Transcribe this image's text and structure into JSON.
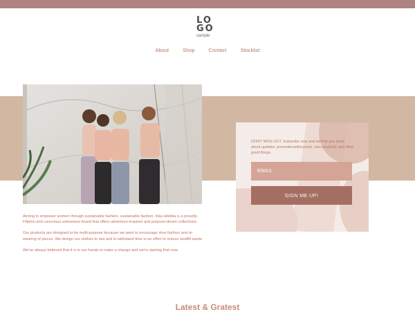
{
  "logo": {
    "line1": "LO",
    "line2": "GO",
    "sub": "sample"
  },
  "nav": {
    "about": "About",
    "shop": "Shop",
    "contact": "Contact",
    "stocklist": "Stocklist"
  },
  "about": {
    "p1": "Aiming to empower women through sustainable fashion, sustainable fashion. Inka atletika is a proudly-Filipino and conscious activewear brand that offers adventure-inspired and purpose-driven collections.",
    "p2": "Our products are designed to be multi-purpose because we want to encourage slow fashion and re-wearing of pieces. We design our clothes to last and to withstand time in an effort to reduce landfill waste",
    "p3": "We've always believed that it is in our hands to make a change and we're starting that now."
  },
  "newsletter": {
    "message": "DON'T MISS OUT. Subscribe now and we'll let you know about updates, promotions/discounts, new products, and other good things.",
    "email_placeholder": "EMAIL",
    "signup_label": "SIGN ME UP!"
  },
  "section": {
    "latest_title": "Latest & Gratest"
  },
  "colors": {
    "topbar": "#b08383",
    "band": "#d2b7a2",
    "accent": "#c2705d",
    "button": "#a46f62"
  }
}
